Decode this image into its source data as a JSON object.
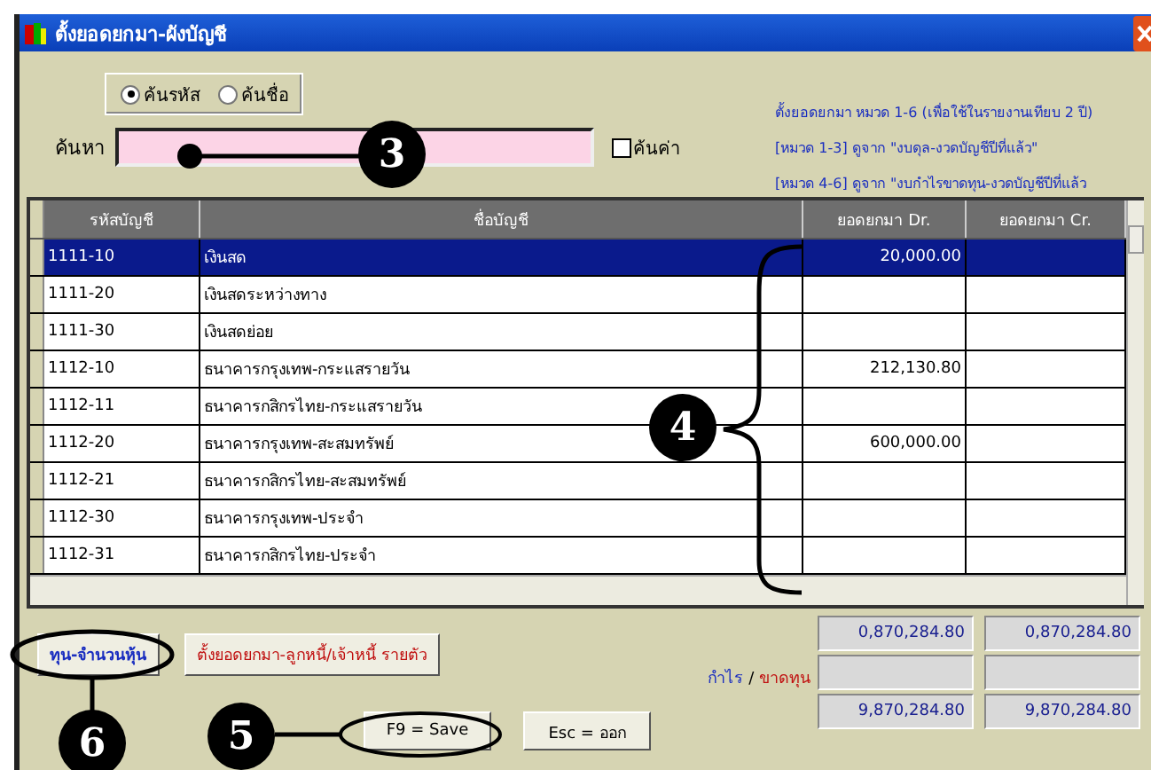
{
  "window": {
    "title": "ตั้งยอดยกมา-ผังบัญชี"
  },
  "search_mode": [
    {
      "label": "ค้นรหัส",
      "selected": true
    },
    {
      "label": "ค้นชื่อ",
      "selected": false
    }
  ],
  "search": {
    "label": "ค้นหา"
  },
  "value_search": {
    "label": "ค้นค่า",
    "checked": false
  },
  "notes": [
    "ตั้งยอดยกมา หมวด 1-6  (เพื่อใช้ในรายงานเทียบ 2 ปี)",
    "[หมวด 1-3]  ดูจาก \"งบดุล-งวดบัญชีปีที่แล้ว\"",
    "[หมวด 4-6]  ดูจาก \"งบกำไรขาดทุน-งวดบัญชีปีที่แล้ว"
  ],
  "table": {
    "columns": [
      "รหัสบัญชี",
      "ชื่อบัญชี",
      "ยอดยกมา Dr.",
      "ยอดยกมา Cr."
    ],
    "rows": [
      {
        "code": "1111-10",
        "name": "เงินสด",
        "dr": "20,000.00",
        "cr": "",
        "selected": true
      },
      {
        "code": "1111-20",
        "name": "เงินสดระหว่างทาง",
        "dr": "",
        "cr": "",
        "selected": false
      },
      {
        "code": "1111-30",
        "name": "เงินสดย่อย",
        "dr": "",
        "cr": "",
        "selected": false
      },
      {
        "code": "1112-10",
        "name": "ธนาคารกรุงเทพ-กระแสรายวัน",
        "dr": "212,130.80",
        "cr": "",
        "selected": false
      },
      {
        "code": "1112-11",
        "name": "ธนาคารกสิกรไทย-กระแสรายวัน",
        "dr": "",
        "cr": "",
        "selected": false
      },
      {
        "code": "1112-20",
        "name": "ธนาคารกรุงเทพ-สะสมทรัพย์",
        "dr": "600,000.00",
        "cr": "",
        "selected": false
      },
      {
        "code": "1112-21",
        "name": "ธนาคารกสิกรไทย-สะสมทรัพย์",
        "dr": "",
        "cr": "",
        "selected": false
      },
      {
        "code": "1112-30",
        "name": "ธนาคารกรุงเทพ-ประจำ",
        "dr": "",
        "cr": "",
        "selected": false
      },
      {
        "code": "1112-31",
        "name": "ธนาคารกสิกรไทย-ประจำ",
        "dr": "",
        "cr": "",
        "selected": false
      }
    ]
  },
  "buttons": [
    {
      "label": "ทุน-จำนวนหุ้น",
      "kind": "blue"
    },
    {
      "label": "ตั้งยอดยกมา-ลูกหนี้/เจ้าหนี้ รายตัว",
      "kind": "red"
    }
  ],
  "totals": {
    "label_profit": "กำไร",
    "label_sep": "/",
    "label_loss": "ขาดทุน",
    "rows": [
      {
        "dr": "0,870,284.80",
        "cr": "0,870,284.80"
      },
      {},
      {
        "dr": "9,870,284.80",
        "cr": "9,870,284.80"
      }
    ]
  },
  "actions": [
    "F9 = Save",
    "Esc = ออก"
  ],
  "callouts": [
    "3",
    "4",
    "5",
    "6"
  ]
}
